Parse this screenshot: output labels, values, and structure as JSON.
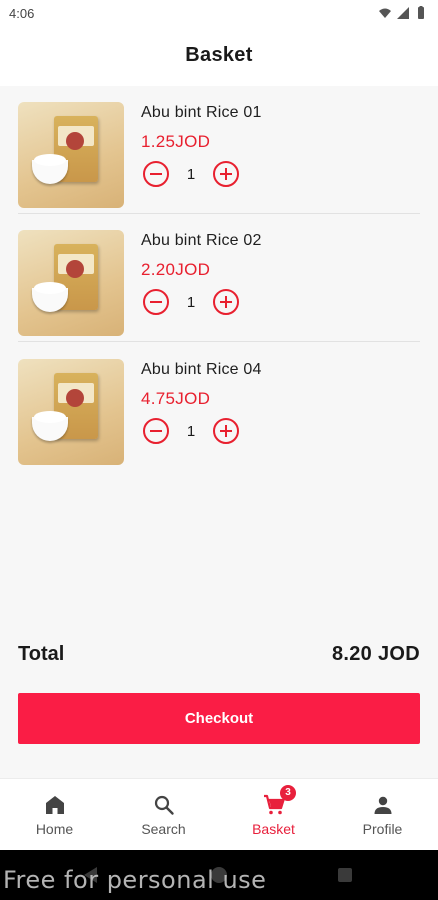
{
  "status_bar": {
    "time": "4:06",
    "icons": [
      "wifi-icon",
      "signal-icon",
      "battery-icon"
    ]
  },
  "header": {
    "title": "Basket"
  },
  "items": [
    {
      "name": "Abu bint Rice 01",
      "price": "1.25JOD",
      "quantity": "1"
    },
    {
      "name": "Abu bint Rice 02",
      "price": "2.20JOD",
      "quantity": "1"
    },
    {
      "name": "Abu bint Rice 04",
      "price": "4.75JOD",
      "quantity": "1"
    }
  ],
  "summary": {
    "total_label": "Total",
    "total_value": "8.20 JOD"
  },
  "checkout": {
    "label": "Checkout"
  },
  "bottom_nav": {
    "items": [
      {
        "label": "Home",
        "icon": "home-icon"
      },
      {
        "label": "Search",
        "icon": "search-icon"
      },
      {
        "label": "Basket",
        "icon": "cart-icon",
        "badge": "3",
        "active": true
      },
      {
        "label": "Profile",
        "icon": "person-icon"
      }
    ]
  },
  "watermark": "Free for personal use",
  "colors": {
    "accent": "#e8202f",
    "checkout": "#fa1d45",
    "active_nav": "#e8203c"
  }
}
